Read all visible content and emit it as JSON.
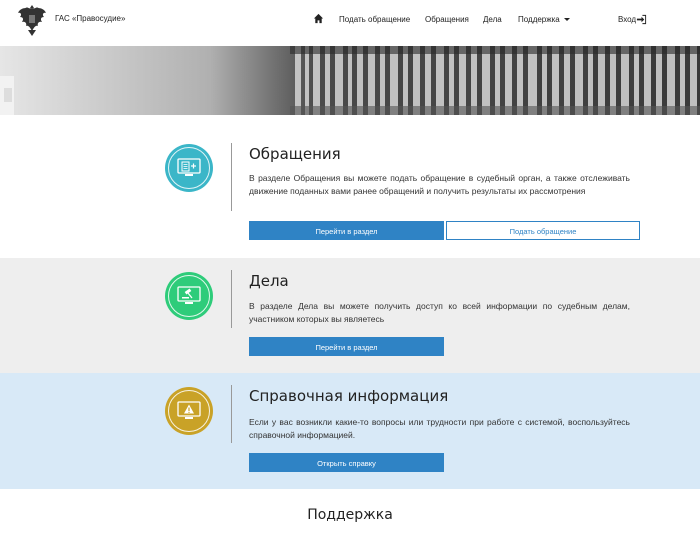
{
  "header": {
    "brand": "ГАС «Правосудие»",
    "nav": {
      "home_icon": "home-icon",
      "items": [
        "Подать обращение",
        "Обращения",
        "Дела",
        "Поддержка"
      ],
      "login": "Вход"
    }
  },
  "sections": {
    "appeals": {
      "title": "Обращения",
      "text": "В разделе Обращения вы можете подать обращение в судебный орган, а также отслеживать движение поданных вами ранее обращений и получить результаты их рассмотрения",
      "btn_go": "Перейти в раздел",
      "btn_submit": "Подать обращение",
      "color": "#3bb6c8"
    },
    "cases": {
      "title": "Дела",
      "text": "В разделе Дела вы можете получить доступ ко всей информации по судебным делам, участником которых вы являетесь",
      "btn_go": "Перейти в раздел",
      "color": "#2ecc7a"
    },
    "help": {
      "title": "Справочная информация",
      "text": "Если у вас возникли какие-то вопросы или трудности при работе с системой, воспользуйтесь справочной информацией.",
      "btn_open": "Открыть справку",
      "color": "#c9a227"
    }
  },
  "support": {
    "title": "Поддержка"
  },
  "colors": {
    "primary": "#2f83c5",
    "gray_section": "#eeeeee",
    "blue_section": "#d8e9f7"
  }
}
